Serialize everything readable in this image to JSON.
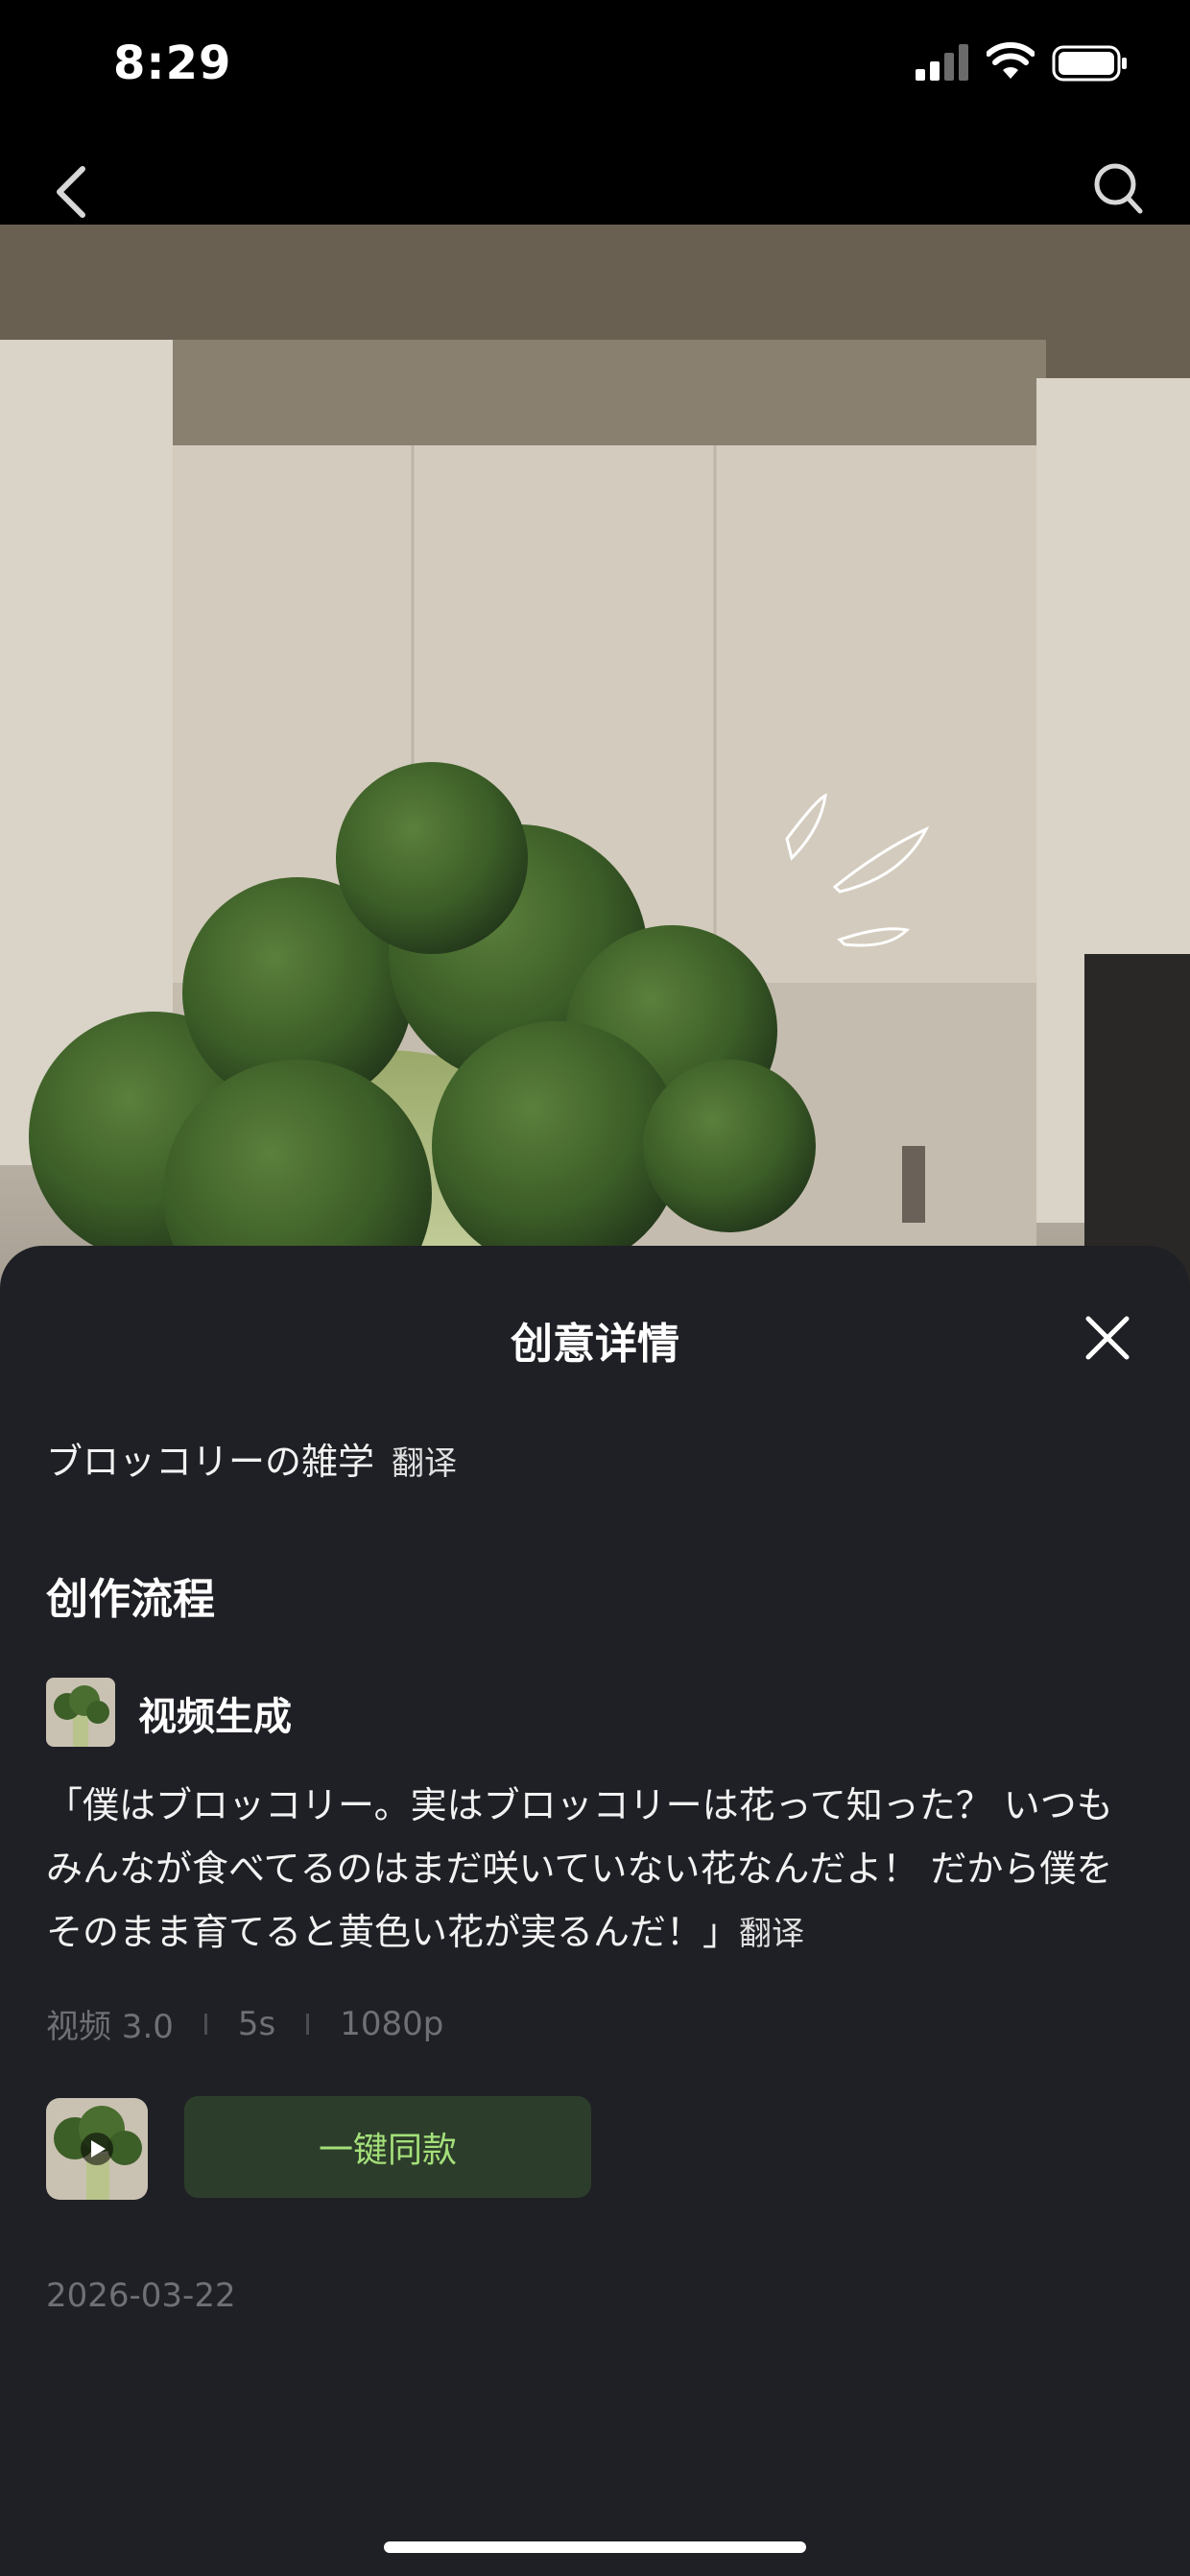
{
  "status": {
    "time": "8:29"
  },
  "nav": {
    "back_icon": "chevron-left-icon",
    "search_icon": "search-icon"
  },
  "sheet": {
    "title": "创意详情",
    "subtitle": "ブロッコリーの雑学",
    "subtitle_translate": "翻译",
    "section_title": "创作流程",
    "step": {
      "name": "视频生成",
      "prompt": "「僕はブロッコリー。実はブロッコリーは花って知った？ いつもみんなが食べてるのはまだ咲いていない花なんだよ！ だから僕をそのまま育てると黄色い花が実るんだ！」",
      "prompt_translate": "翻译",
      "model": "视频 3.0",
      "duration": "5s",
      "resolution": "1080p"
    },
    "clone_button": "一键同款",
    "date": "2026-03-22"
  },
  "colors": {
    "sheet_bg": "#1f2025",
    "accent": "#a4e07a",
    "button_bg": "#2d3d2b"
  }
}
